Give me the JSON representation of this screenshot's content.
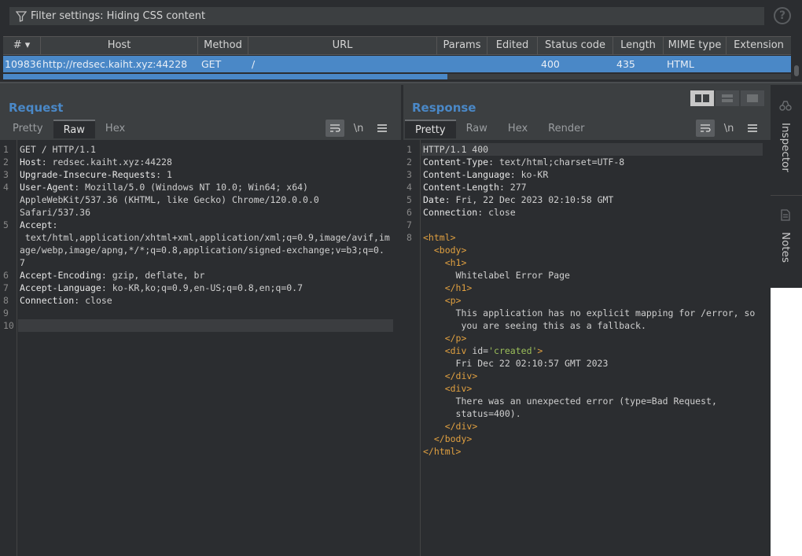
{
  "filter": {
    "text": "Filter settings: Hiding CSS content"
  },
  "table": {
    "headers": [
      "#",
      "Host",
      "Method",
      "URL",
      "Params",
      "Edited",
      "Status code",
      "Length",
      "MIME type",
      "Extension"
    ],
    "row": {
      "num": "109836",
      "host": "http://redsec.kaiht.xyz:44228",
      "method": "GET",
      "url": "/",
      "params": "",
      "edited": "",
      "status": "400",
      "length": "435",
      "mime": "HTML",
      "extension": ""
    }
  },
  "request": {
    "title": "Request",
    "tabs": [
      "Pretty",
      "Raw",
      "Hex"
    ],
    "active_tab": "Raw",
    "line_numbers": [
      "1",
      "2",
      "3",
      "4",
      "5",
      "6",
      "7",
      "8",
      "9",
      "10"
    ],
    "lines": [
      {
        "n": "1",
        "text": "GET / HTTP/1.1"
      },
      {
        "n": "2",
        "text": "Host: redsec.kaiht.xyz:44228"
      },
      {
        "n": "3",
        "text": "Upgrade-Insecure-Requests: 1"
      },
      {
        "n": "4",
        "text": "User-Agent: Mozilla/5.0 (Windows NT 10.0; Win64; x64)"
      },
      {
        "n": "",
        "text": "AppleWebKit/537.36 (KHTML, like Gecko) Chrome/120.0.0.0"
      },
      {
        "n": "",
        "text": "Safari/537.36"
      },
      {
        "n": "5",
        "text": "Accept:"
      },
      {
        "n": "",
        "text": " text/html,application/xhtml+xml,application/xml;q=0.9,image/avif,im"
      },
      {
        "n": "",
        "text": "age/webp,image/apng,*/*;q=0.8,application/signed-exchange;v=b3;q=0."
      },
      {
        "n": "",
        "text": "7"
      },
      {
        "n": "6",
        "text": "Accept-Encoding: gzip, deflate, br"
      },
      {
        "n": "7",
        "text": "Accept-Language: ko-KR,ko;q=0.9,en-US;q=0.8,en;q=0.7"
      },
      {
        "n": "8",
        "text": "Connection: close"
      },
      {
        "n": "9",
        "text": ""
      },
      {
        "n": "10",
        "text": ""
      }
    ]
  },
  "response": {
    "title": "Response",
    "tabs": [
      "Pretty",
      "Raw",
      "Hex",
      "Render"
    ],
    "active_tab": "Pretty",
    "lines": [
      {
        "n": "1",
        "text": "HTTP/1.1 400"
      },
      {
        "n": "2",
        "text": "Content-Type: text/html;charset=UTF-8"
      },
      {
        "n": "3",
        "text": "Content-Language: ko-KR"
      },
      {
        "n": "4",
        "text": "Content-Length: 277"
      },
      {
        "n": "5",
        "text": "Date: Fri, 22 Dec 2023 02:10:58 GMT"
      },
      {
        "n": "6",
        "text": "Connection: close"
      },
      {
        "n": "7",
        "text": ""
      },
      {
        "n": "8",
        "text": "<html>"
      },
      {
        "n": "",
        "text": "  <body>"
      },
      {
        "n": "",
        "text": "    <h1>"
      },
      {
        "n": "",
        "text": "      Whitelabel Error Page"
      },
      {
        "n": "",
        "text": "    </h1>"
      },
      {
        "n": "",
        "text": "    <p>"
      },
      {
        "n": "",
        "text": "      This application has no explicit mapping for /error, so"
      },
      {
        "n": "",
        "text": "       you are seeing this as a fallback."
      },
      {
        "n": "",
        "text": "    </p>"
      },
      {
        "n": "",
        "text": "    <div id='created'>"
      },
      {
        "n": "",
        "text": "      Fri Dec 22 02:10:57 GMT 2023"
      },
      {
        "n": "",
        "text": "    </div>"
      },
      {
        "n": "",
        "text": "    <div>"
      },
      {
        "n": "",
        "text": "      There was an unexpected error (type=Bad Request,"
      },
      {
        "n": "",
        "text": "      status=400)."
      },
      {
        "n": "",
        "text": "    </div>"
      },
      {
        "n": "",
        "text": "  </body>"
      },
      {
        "n": "",
        "text": "</html>"
      }
    ]
  },
  "toolbar": {
    "newline_label": "\\n"
  },
  "sidebar": {
    "inspector": "Inspector",
    "notes": "Notes"
  },
  "colors": {
    "accent": "#4a88c7",
    "bg": "#3c3f41",
    "editor_bg": "#2b2d30",
    "tag": "#e0a040",
    "string": "#9cbf5a"
  }
}
